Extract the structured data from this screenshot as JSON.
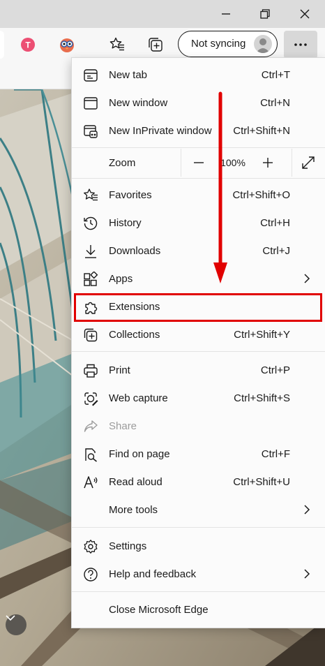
{
  "titlebar": {
    "buttons": [
      "minimize",
      "restore",
      "close"
    ]
  },
  "toolbar": {
    "sync_label": "Not syncing",
    "icons": [
      "ttrack-extension-icon",
      "owl-extension-icon",
      "favorites-icon",
      "collections-icon"
    ]
  },
  "menu": {
    "items": [
      {
        "label": "New tab",
        "shortcut": "Ctrl+T",
        "icon": "new-tab-icon"
      },
      {
        "label": "New window",
        "shortcut": "Ctrl+N",
        "icon": "new-window-icon"
      },
      {
        "label": "New InPrivate window",
        "shortcut": "Ctrl+Shift+N",
        "icon": "inprivate-icon"
      },
      {
        "label": "Favorites",
        "shortcut": "Ctrl+Shift+O",
        "icon": "favorites-icon"
      },
      {
        "label": "History",
        "shortcut": "Ctrl+H",
        "icon": "history-icon"
      },
      {
        "label": "Downloads",
        "shortcut": "Ctrl+J",
        "icon": "download-icon"
      },
      {
        "label": "Apps",
        "shortcut": "",
        "icon": "apps-icon"
      },
      {
        "label": "Extensions",
        "shortcut": "",
        "icon": "extensions-icon"
      },
      {
        "label": "Collections",
        "shortcut": "Ctrl+Shift+Y",
        "icon": "collections-icon"
      },
      {
        "label": "Print",
        "shortcut": "Ctrl+P",
        "icon": "print-icon"
      },
      {
        "label": "Web capture",
        "shortcut": "Ctrl+Shift+S",
        "icon": "web-capture-icon"
      },
      {
        "label": "Share",
        "shortcut": "",
        "icon": "share-icon"
      },
      {
        "label": "Find on page",
        "shortcut": "Ctrl+F",
        "icon": "find-icon"
      },
      {
        "label": "Read aloud",
        "shortcut": "Ctrl+Shift+U",
        "icon": "read-aloud-icon"
      },
      {
        "label": "More tools",
        "shortcut": "",
        "icon": ""
      },
      {
        "label": "Settings",
        "shortcut": "",
        "icon": "settings-icon"
      },
      {
        "label": "Help and feedback",
        "shortcut": "",
        "icon": "help-icon"
      },
      {
        "label": "Close Microsoft Edge",
        "shortcut": "",
        "icon": ""
      }
    ],
    "zoom": {
      "label": "Zoom",
      "value": "100%"
    }
  },
  "colors": {
    "highlight": "#e10000",
    "menu_bg": "#fbfbfb",
    "titlebar_bg": "#dcdcdc"
  }
}
